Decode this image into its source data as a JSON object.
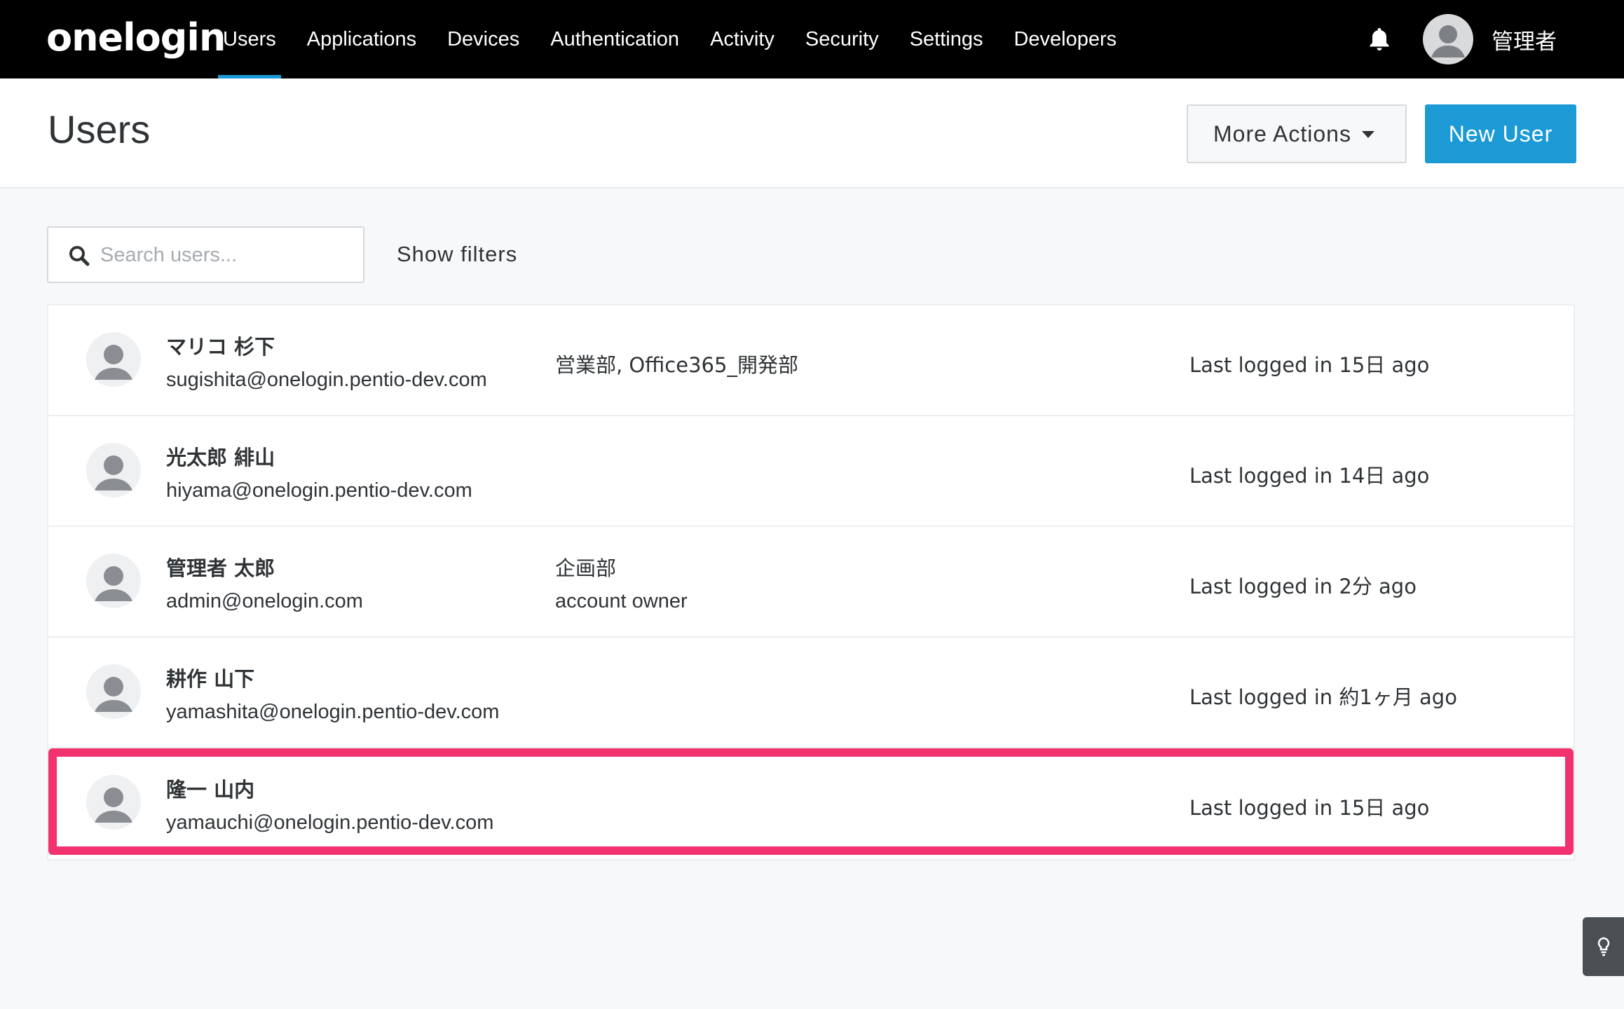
{
  "topnav": {
    "logo": "onelogin",
    "items": [
      {
        "label": "Users",
        "active": true
      },
      {
        "label": "Applications"
      },
      {
        "label": "Devices"
      },
      {
        "label": "Authentication"
      },
      {
        "label": "Activity"
      },
      {
        "label": "Security"
      },
      {
        "label": "Settings"
      },
      {
        "label": "Developers"
      }
    ],
    "notification_icon": "bell-icon",
    "user_name": "管理者"
  },
  "header": {
    "title": "Users",
    "more_actions_label": "More Actions",
    "new_user_label": "New User"
  },
  "search": {
    "placeholder": "Search users...",
    "value": "",
    "show_filters_label": "Show filters"
  },
  "users": [
    {
      "name": "マリコ 杉下",
      "email": "sugishita@onelogin.pentio-dev.com",
      "group": "営業部, Office365_開発部",
      "role": "",
      "last_login": "Last logged in 15日 ago"
    },
    {
      "name": "光太郎 緋山",
      "email": "hiyama@onelogin.pentio-dev.com",
      "group": "",
      "role": "",
      "last_login": "Last logged in 14日 ago"
    },
    {
      "name": "管理者 太郎",
      "email": "admin@onelogin.com",
      "group": "企画部",
      "role": "account owner",
      "last_login": "Last logged in 2分 ago"
    },
    {
      "name": "耕作 山下",
      "email": "yamashita@onelogin.pentio-dev.com",
      "group": "",
      "role": "",
      "last_login": "Last logged in 約1ヶ月 ago"
    },
    {
      "name": "隆一 山内",
      "email": "yamauchi@onelogin.pentio-dev.com",
      "group": "",
      "role": "",
      "last_login": "Last logged in 15日 ago",
      "highlighted": true
    }
  ],
  "colors": {
    "nav_bg": "#000000",
    "accent": "#1c9ad6",
    "highlight": "#f2326f"
  }
}
